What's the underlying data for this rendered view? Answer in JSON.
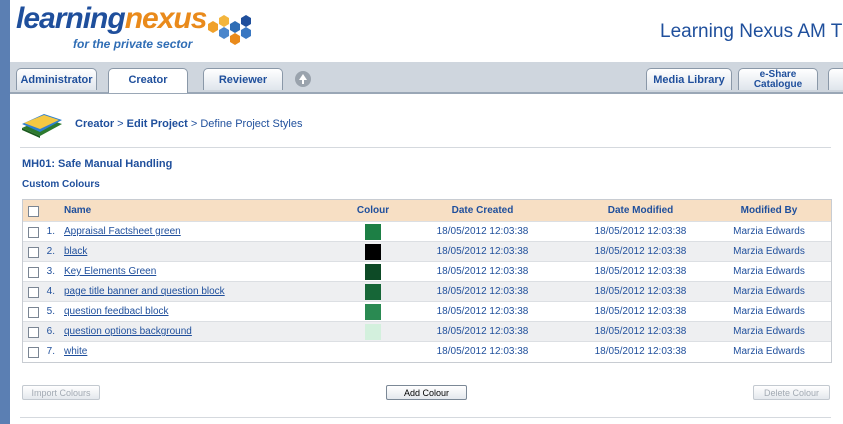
{
  "header": {
    "logo_main_a": "learning",
    "logo_main_b": "nexus",
    "logo_sub": "for the private sector",
    "app_title": "Learning Nexus AM T"
  },
  "tabs": {
    "administrator": "Administrator",
    "creator": "Creator",
    "reviewer": "Reviewer",
    "media_library": "Media Library",
    "eshare_line1": "e-Share",
    "eshare_line2": "Catalogue"
  },
  "breadcrumb": {
    "creator": "Creator",
    "sep1": " > ",
    "edit_project": "Edit Project",
    "sep2": " > ",
    "current": "Define Project Styles"
  },
  "project": {
    "title": "MH01: Safe Manual Handling"
  },
  "section": {
    "title": "Custom Colours"
  },
  "table": {
    "headers": {
      "name": "Name",
      "colour": "Colour",
      "date_created": "Date Created",
      "date_modified": "Date Modified",
      "modified_by": "Modified By"
    },
    "rows": [
      {
        "num": "1.",
        "name": "Appraisal Factsheet green",
        "color": "#1d7f45",
        "created": "18/05/2012 12:03:38",
        "modified": "18/05/2012 12:03:38",
        "by": "Marzia Edwards"
      },
      {
        "num": "2.",
        "name": "black",
        "color": "#000000",
        "created": "18/05/2012 12:03:38",
        "modified": "18/05/2012 12:03:38",
        "by": "Marzia Edwards"
      },
      {
        "num": "3.",
        "name": "Key Elements Green",
        "color": "#0d4a26",
        "created": "18/05/2012 12:03:38",
        "modified": "18/05/2012 12:03:38",
        "by": "Marzia Edwards"
      },
      {
        "num": "4.",
        "name": "page title banner and question block",
        "color": "#166637",
        "created": "18/05/2012 12:03:38",
        "modified": "18/05/2012 12:03:38",
        "by": "Marzia Edwards"
      },
      {
        "num": "5.",
        "name": "question feedbacl block",
        "color": "#2a8a52",
        "created": "18/05/2012 12:03:38",
        "modified": "18/05/2012 12:03:38",
        "by": "Marzia Edwards"
      },
      {
        "num": "6.",
        "name": "question options background",
        "color": "#d3f0dd",
        "created": "18/05/2012 12:03:38",
        "modified": "18/05/2012 12:03:38",
        "by": "Marzia Edwards"
      },
      {
        "num": "7.",
        "name": "white",
        "color": "#ffffff",
        "created": "18/05/2012 12:03:38",
        "modified": "18/05/2012 12:03:38",
        "by": "Marzia Edwards"
      }
    ]
  },
  "buttons": {
    "import": "Import Colours",
    "add": "Add Colour",
    "delete": "Delete Colour"
  },
  "icons": {
    "logo_hexes": "hexagon-cluster-icon",
    "up": "up-arrow-circle-icon",
    "book": "book-stack-icon"
  }
}
